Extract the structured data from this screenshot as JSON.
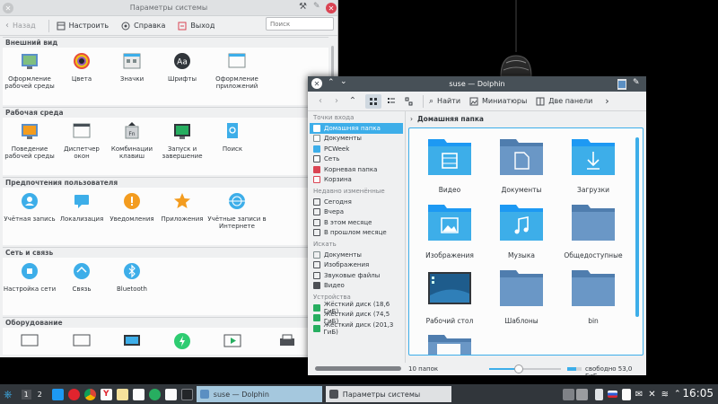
{
  "settings": {
    "title": "Параметры системы",
    "toolbar": {
      "back": "Назад",
      "configure": "Настроить",
      "help": "Справка",
      "quit": "Выход"
    },
    "search_placeholder": "Поиск",
    "sections": [
      {
        "title": "Внешний вид",
        "modules": [
          {
            "label": "Оформление рабочей среды",
            "icon": "desktop-theme-icon"
          },
          {
            "label": "Цвета",
            "icon": "colors-icon"
          },
          {
            "label": "Значки",
            "icon": "icons-icon"
          },
          {
            "label": "Шрифты",
            "icon": "fonts-icon"
          },
          {
            "label": "Оформление приложений",
            "icon": "app-style-icon"
          }
        ]
      },
      {
        "title": "Рабочая среда",
        "modules": [
          {
            "label": "Поведение рабочей среды",
            "icon": "desktop-behavior-icon"
          },
          {
            "label": "Диспетчер окон",
            "icon": "window-manager-icon"
          },
          {
            "label": "Комбинации клавиш",
            "icon": "shortcuts-icon"
          },
          {
            "label": "Запуск и завершение",
            "icon": "startup-icon"
          },
          {
            "label": "Поиск",
            "icon": "search-icon"
          }
        ]
      },
      {
        "title": "Предпочтения пользователя",
        "modules": [
          {
            "label": "Учётная запись",
            "icon": "account-icon"
          },
          {
            "label": "Локализация",
            "icon": "locale-icon"
          },
          {
            "label": "Уведомления",
            "icon": "notifications-icon"
          },
          {
            "label": "Приложения",
            "icon": "applications-icon"
          },
          {
            "label": "Учётные записи в Интернете",
            "icon": "online-accounts-icon"
          }
        ]
      },
      {
        "title": "Сеть и связь",
        "modules": [
          {
            "label": "Настройка сети",
            "icon": "network-icon"
          },
          {
            "label": "Связь",
            "icon": "connectivity-icon"
          },
          {
            "label": "Bluetooth",
            "icon": "bluetooth-icon"
          }
        ]
      },
      {
        "title": "Оборудование",
        "modules": []
      }
    ]
  },
  "dolphin": {
    "title": "suse — Dolphin",
    "toolbar": {
      "find": "Найти",
      "thumbnails": "Миниатюры",
      "split": "Две панели"
    },
    "places": {
      "group_places": "Точки входа",
      "items": [
        "Домашняя папка",
        "Документы",
        "PCWeek",
        "Сеть",
        "Корневая папка",
        "Корзина"
      ],
      "group_recent": "Недавно изменённые",
      "recent": [
        "Сегодня",
        "Вчера",
        "В этом месяце",
        "В прошлом месяце"
      ],
      "group_search": "Искать",
      "search": [
        "Документы",
        "Изображения",
        "Звуковые файлы",
        "Видео"
      ],
      "group_devices": "Устройства",
      "devices": [
        "Жёсткий диск (18,6 ГиБ)",
        "Жёсткий диск (74,5 ГиБ)",
        "Жёсткий диск (201,3 ГиБ)"
      ]
    },
    "breadcrumb": "Домашняя папка",
    "files": [
      "Видео",
      "Документы",
      "Загрузки",
      "Изображения",
      "Музыка",
      "Общедоступные",
      "Рабочий стол",
      "Шаблоны",
      "bin"
    ],
    "status": {
      "count": "10 папок",
      "free": "свободно 53,0 ГиБ",
      "disk_used_fraction": 0.62
    }
  },
  "taskbar": {
    "desktops": [
      "1",
      "2"
    ],
    "tasks": [
      "suse — Dolphin",
      "Параметры системы"
    ],
    "clock": "16:05"
  }
}
